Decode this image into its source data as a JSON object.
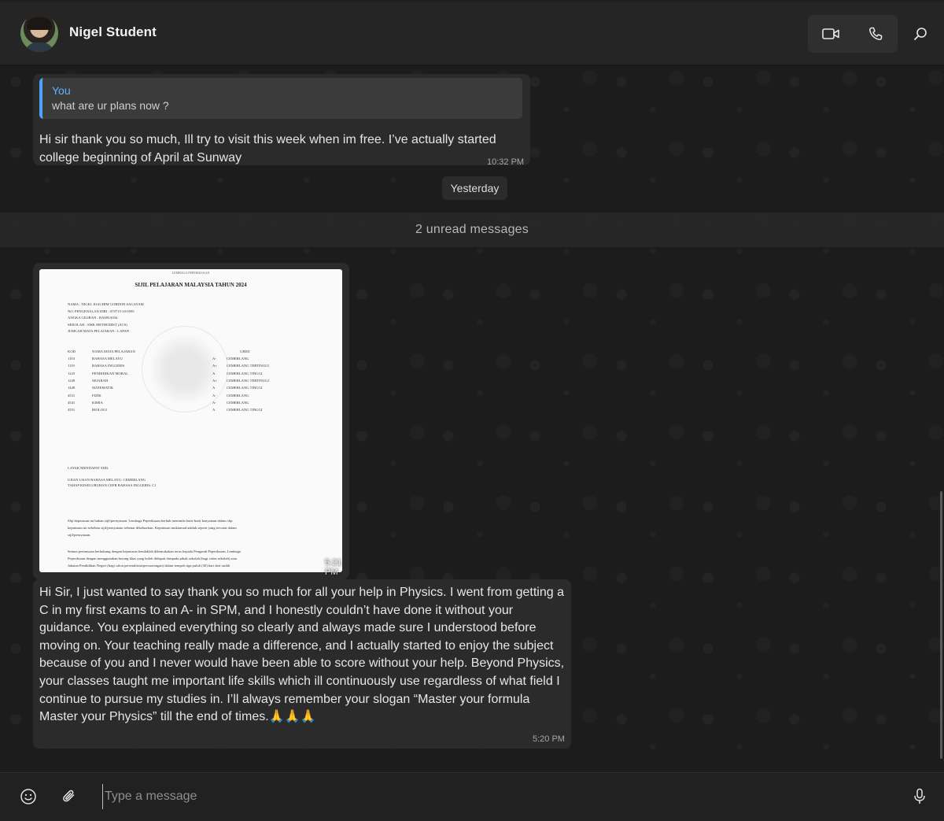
{
  "header": {
    "contact_name": "Nigel Student"
  },
  "messages": {
    "reply": {
      "quote_author": "You",
      "quote_text": "what are ur plans now ?",
      "text": "Hi sir thank you so much, Ill try to visit this week when im free. I’ve actually started college beginning of April at Sunway",
      "time": "10:32 PM"
    },
    "date_separator": "Yesterday",
    "unread_banner": "2 unread messages",
    "image_message": {
      "time": "5:21 PM",
      "document": {
        "header": "LEMBAGA PEPERIKSAAN",
        "title": "SIJIL PELAJARAN MALAYSIA TAHUN 2024",
        "lines": [
          "NAMA : NIGEL JOACHIM GORDON SAGAYAM",
          "NO. PENGENALAN DIRI : 070715-10-0595",
          "ANGKA GILIRAN : BA005A034",
          "SEKOLAH : SMK METHODIST (ACS)",
          "JUMLAH MATA PELAJARAN : LAPAN"
        ],
        "columns": [
          "KOD",
          "NAMA MATA PELAJARAN",
          "GRED"
        ],
        "subjects": [
          {
            "kod": "1103",
            "name": "BAHASA MELAYU",
            "grade": "A-",
            "label": "CEMERLANG"
          },
          {
            "kod": "1119",
            "name": "BAHASA INGGERIS",
            "grade": "A+",
            "label": "CEMERLANG TERTINGGI"
          },
          {
            "kod": "1225",
            "name": "PENDIDIKAN MORAL",
            "grade": "A",
            "label": "CEMERLANG TINGGI"
          },
          {
            "kod": "1249",
            "name": "SEJARAH",
            "grade": "A+",
            "label": "CEMERLANG TERTINGGI"
          },
          {
            "kod": "1449",
            "name": "MATEMATIK",
            "grade": "A",
            "label": "CEMERLANG TINGGI"
          },
          {
            "kod": "4531",
            "name": "FIZIK",
            "grade": "A-",
            "label": "CEMERLANG"
          },
          {
            "kod": "4541",
            "name": "KIMIA",
            "grade": "A-",
            "label": "CEMERLANG"
          },
          {
            "kod": "4551",
            "name": "BIOLOGI",
            "grade": "A",
            "label": "CEMERLANG TINGGI"
          }
        ],
        "footer_lines": [
          "LAYAK MENDAPAT SIJIL",
          "UJIAN LISAN BAHASA MELAYU: CEMERLANG",
          "TAHAP KESELURUHAN CEFR BAHASA INGGERIS: C1",
          "Slip keputusan ini bukan sijil/pernyataan. Lembaga Peperiksaan berhak meminda butir-butir kenyataan dalam slip",
          "keputusan ini sebelum sijil/pernyataan sebenar dikeluarkan. Keputusan muktamad adalah seperti yang tercatat dalam",
          "sijil/pernyataan.",
          "Semua pertanyaan berhubung dengan keputusan hendaklah dikemukakan terus kepada Pengarah Peperiksaan, Lembaga",
          "Peperiksaan dengan menggunakan borang khas yang boleh didapati daripada pihak sekolah (bagi calon sekolah) atau",
          "Jabatan Pendidikan Negeri (bagi calon persendirian/persaorangan) dalam tempoh tiga puluh (30) hari dari tarikh"
        ]
      }
    },
    "thank_you": {
      "text": "Hi Sir, I just wanted to say thank you so much for all your help in Physics. I went from getting a C in my first exams to an A- in SPM, and I honestly couldn’t have done it without your guidance. You explained everything so clearly and always made sure I understood before moving on. Your teaching really made a difference, and I actually started to enjoy the subject because of you and I never would have been able to score without your help. Beyond Physics, your classes taught me important life skills which ill continuously use regardless of what field I continue to pursue my studies in. I’ll always remember your slogan “Master your formula Master your Physics” till the end of times.🙏🙏🙏",
      "time": "5:20 PM"
    }
  },
  "composer": {
    "placeholder": "Type a message"
  },
  "colors": {
    "accent": "#4da3ff",
    "bubble": "#2b2b2b",
    "background": "#1c1c1c"
  },
  "icons": [
    "video-call-icon",
    "voice-call-icon",
    "search-icon",
    "emoji-icon",
    "attach-icon",
    "microphone-icon"
  ]
}
